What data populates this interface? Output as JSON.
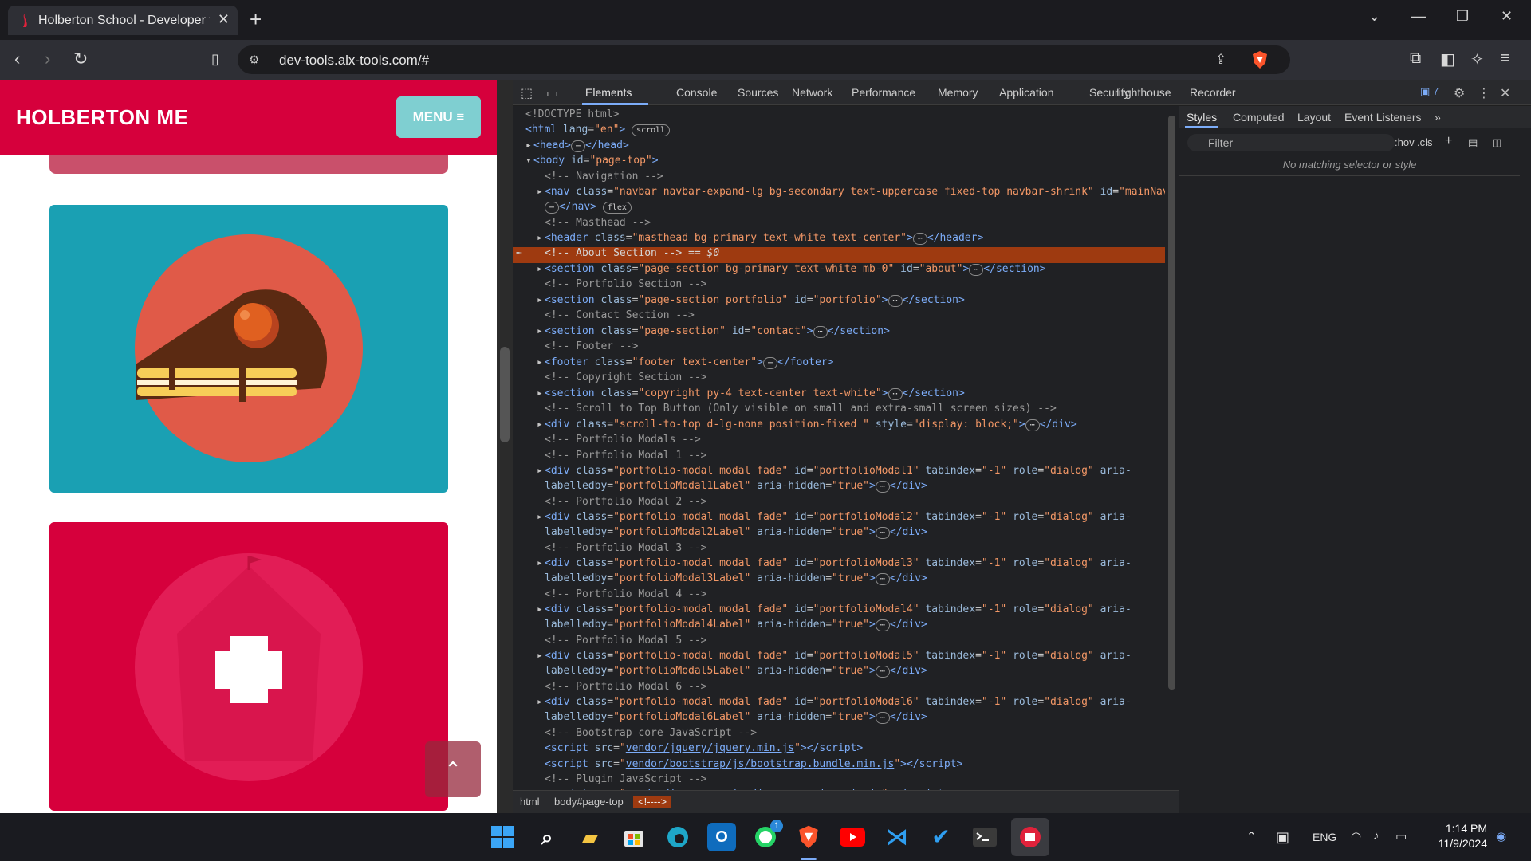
{
  "browser": {
    "tab_title": "Holberton School - Developer t",
    "url": "dev-tools.alx-tools.com/#"
  },
  "page": {
    "brand": "HOLBERTON ME",
    "menu_label": "MENU ≡"
  },
  "devtools": {
    "tabs": [
      "Elements",
      "Console",
      "Sources",
      "Network",
      "Performance",
      "Memory",
      "Application",
      "Security",
      "Lighthouse",
      "Recorder"
    ],
    "issues_count": "7",
    "styles_tabs": [
      "Styles",
      "Computed",
      "Layout",
      "Event Listeners"
    ],
    "filter_placeholder": "Filter",
    "hov": ":hov",
    "cls": ".cls",
    "no_match": "No matching selector or style",
    "breadcrumbs": [
      "html",
      "body#page-top",
      "<!---->"
    ]
  },
  "taskbar": {
    "language": "ENG",
    "time": "1:14 PM",
    "date": "11/9/2024",
    "whatsapp_badge": "1"
  }
}
